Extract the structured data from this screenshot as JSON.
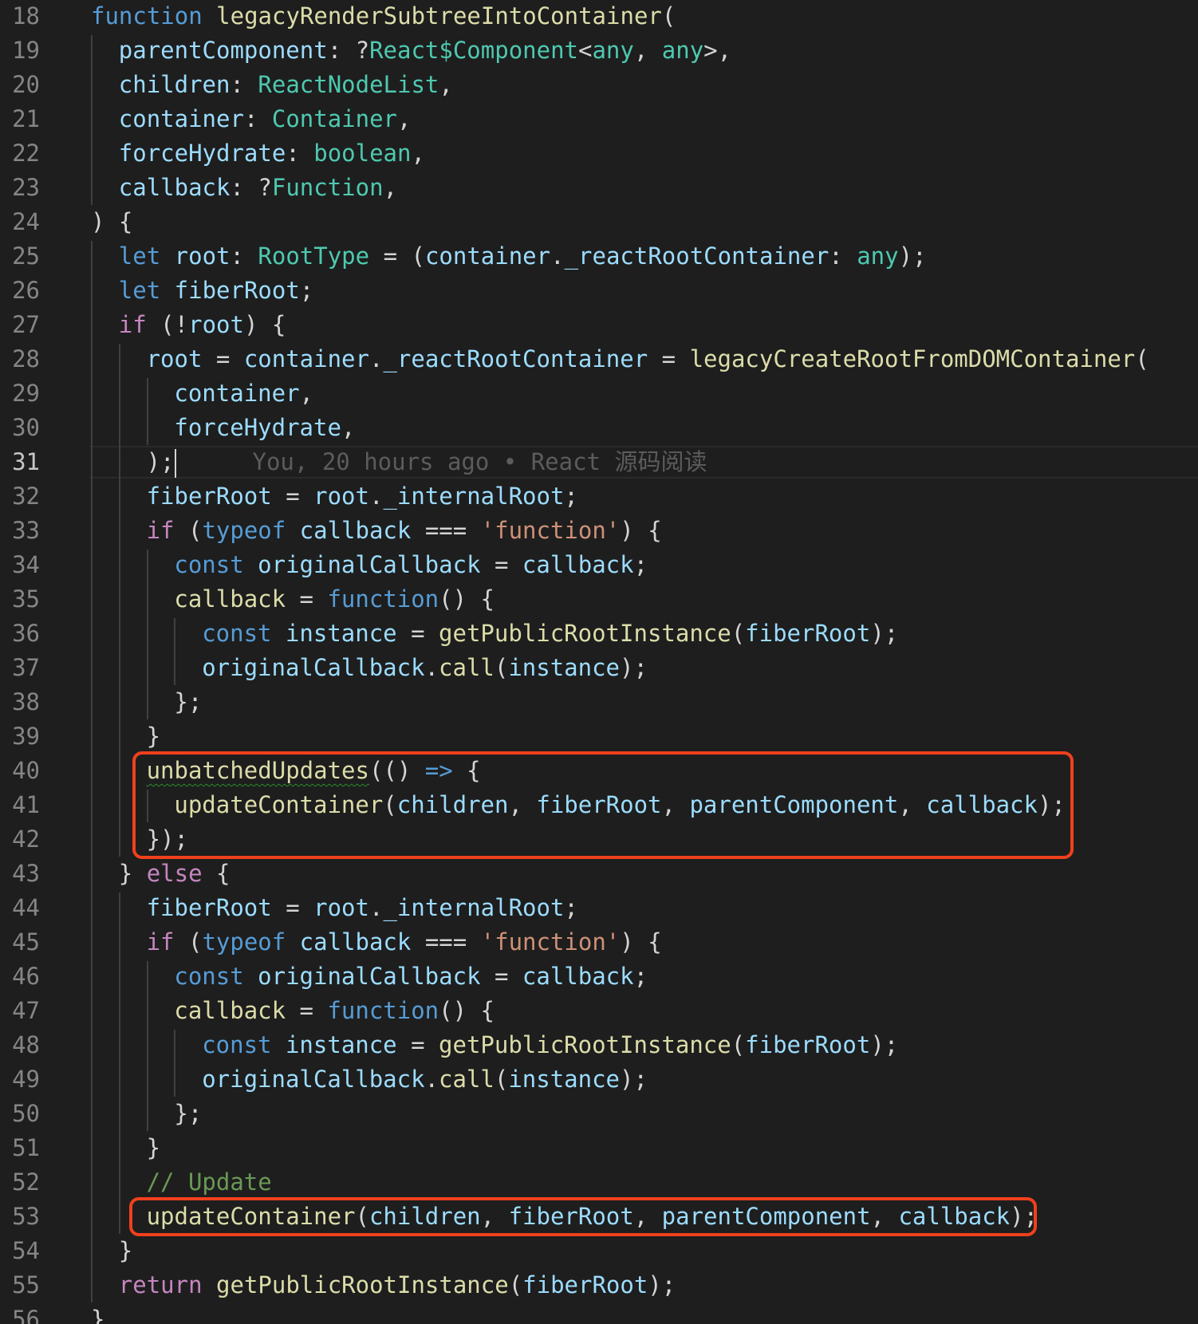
{
  "colors": {
    "background": "#1e1e1e",
    "keyword": "#569cd6",
    "control": "#c586c0",
    "function": "#dcdcaa",
    "variable": "#9cdcfe",
    "type": "#4ec9b0",
    "string": "#ce9178",
    "comment": "#6a9955",
    "highlight": "#f0401c"
  },
  "editor": {
    "current_line": "31",
    "blame_text": "You, 20 hours ago • React 源码阅读",
    "lines": [
      {
        "num": "18",
        "indent": 0,
        "tokens": [
          [
            "k",
            "function"
          ],
          [
            "p",
            " "
          ],
          [
            "f",
            "legacyRenderSubtreeIntoContainer"
          ],
          [
            "p",
            "("
          ]
        ]
      },
      {
        "num": "19",
        "indent": 1,
        "tokens": [
          [
            "v",
            "parentComponent"
          ],
          [
            "p",
            ": ?"
          ],
          [
            "t",
            "React$Component"
          ],
          [
            "p",
            "<"
          ],
          [
            "t",
            "any"
          ],
          [
            "p",
            ", "
          ],
          [
            "t",
            "any"
          ],
          [
            "p",
            ">,"
          ]
        ]
      },
      {
        "num": "20",
        "indent": 1,
        "tokens": [
          [
            "v",
            "children"
          ],
          [
            "p",
            ": "
          ],
          [
            "t",
            "ReactNodeList"
          ],
          [
            "p",
            ","
          ]
        ]
      },
      {
        "num": "21",
        "indent": 1,
        "tokens": [
          [
            "v",
            "container"
          ],
          [
            "p",
            ": "
          ],
          [
            "t",
            "Container"
          ],
          [
            "p",
            ","
          ]
        ]
      },
      {
        "num": "22",
        "indent": 1,
        "tokens": [
          [
            "v",
            "forceHydrate"
          ],
          [
            "p",
            ": "
          ],
          [
            "t",
            "boolean"
          ],
          [
            "p",
            ","
          ]
        ]
      },
      {
        "num": "23",
        "indent": 1,
        "tokens": [
          [
            "v",
            "callback"
          ],
          [
            "p",
            ": ?"
          ],
          [
            "t",
            "Function"
          ],
          [
            "p",
            ","
          ]
        ]
      },
      {
        "num": "24",
        "indent": 0,
        "tokens": [
          [
            "p",
            ") {"
          ]
        ]
      },
      {
        "num": "25",
        "indent": 1,
        "tokens": [
          [
            "k",
            "let"
          ],
          [
            "p",
            " "
          ],
          [
            "v",
            "root"
          ],
          [
            "p",
            ": "
          ],
          [
            "t",
            "RootType"
          ],
          [
            "p",
            " = ("
          ],
          [
            "v",
            "container"
          ],
          [
            "p",
            "."
          ],
          [
            "v",
            "_reactRootContainer"
          ],
          [
            "p",
            ": "
          ],
          [
            "t",
            "any"
          ],
          [
            "p",
            ");"
          ]
        ]
      },
      {
        "num": "26",
        "indent": 1,
        "tokens": [
          [
            "k",
            "let"
          ],
          [
            "p",
            " "
          ],
          [
            "v",
            "fiberRoot"
          ],
          [
            "p",
            ";"
          ]
        ]
      },
      {
        "num": "27",
        "indent": 1,
        "tokens": [
          [
            "c",
            "if"
          ],
          [
            "p",
            " (!"
          ],
          [
            "v",
            "root"
          ],
          [
            "p",
            ") {"
          ]
        ]
      },
      {
        "num": "28",
        "indent": 2,
        "tokens": [
          [
            "v",
            "root"
          ],
          [
            "p",
            " = "
          ],
          [
            "v",
            "container"
          ],
          [
            "p",
            "."
          ],
          [
            "v",
            "_reactRootContainer"
          ],
          [
            "p",
            " = "
          ],
          [
            "f",
            "legacyCreateRootFromDOMContainer"
          ],
          [
            "p",
            "("
          ]
        ]
      },
      {
        "num": "29",
        "indent": 3,
        "tokens": [
          [
            "v",
            "container"
          ],
          [
            "p",
            ","
          ]
        ]
      },
      {
        "num": "30",
        "indent": 3,
        "tokens": [
          [
            "v",
            "forceHydrate"
          ],
          [
            "p",
            ","
          ]
        ]
      },
      {
        "num": "31",
        "indent": 2,
        "tokens": [
          [
            "p",
            ");"
          ]
        ]
      },
      {
        "num": "32",
        "indent": 2,
        "tokens": [
          [
            "v",
            "fiberRoot"
          ],
          [
            "p",
            " = "
          ],
          [
            "v",
            "root"
          ],
          [
            "p",
            "."
          ],
          [
            "v",
            "_internalRoot"
          ],
          [
            "p",
            ";"
          ]
        ]
      },
      {
        "num": "33",
        "indent": 2,
        "tokens": [
          [
            "c",
            "if"
          ],
          [
            "p",
            " ("
          ],
          [
            "k",
            "typeof"
          ],
          [
            "p",
            " "
          ],
          [
            "v",
            "callback"
          ],
          [
            "p",
            " === "
          ],
          [
            "s",
            "'function'"
          ],
          [
            "p",
            ") {"
          ]
        ]
      },
      {
        "num": "34",
        "indent": 3,
        "tokens": [
          [
            "k",
            "const"
          ],
          [
            "p",
            " "
          ],
          [
            "v",
            "originalCallback"
          ],
          [
            "p",
            " = "
          ],
          [
            "v",
            "callback"
          ],
          [
            "p",
            ";"
          ]
        ]
      },
      {
        "num": "35",
        "indent": 3,
        "tokens": [
          [
            "f",
            "callback"
          ],
          [
            "p",
            " = "
          ],
          [
            "k",
            "function"
          ],
          [
            "p",
            "() {"
          ]
        ]
      },
      {
        "num": "36",
        "indent": 4,
        "tokens": [
          [
            "k",
            "const"
          ],
          [
            "p",
            " "
          ],
          [
            "v",
            "instance"
          ],
          [
            "p",
            " = "
          ],
          [
            "f",
            "getPublicRootInstance"
          ],
          [
            "p",
            "("
          ],
          [
            "v",
            "fiberRoot"
          ],
          [
            "p",
            ");"
          ]
        ]
      },
      {
        "num": "37",
        "indent": 4,
        "tokens": [
          [
            "v",
            "originalCallback"
          ],
          [
            "p",
            "."
          ],
          [
            "f",
            "call"
          ],
          [
            "p",
            "("
          ],
          [
            "v",
            "instance"
          ],
          [
            "p",
            ");"
          ]
        ]
      },
      {
        "num": "38",
        "indent": 3,
        "tokens": [
          [
            "p",
            "};"
          ]
        ]
      },
      {
        "num": "39",
        "indent": 2,
        "tokens": [
          [
            "p",
            "}"
          ]
        ]
      },
      {
        "num": "40",
        "indent": 2,
        "tokens": [
          [
            "fs",
            "unbatchedUpdates"
          ],
          [
            "p",
            "(() "
          ],
          [
            "k",
            "=>"
          ],
          [
            "p",
            " {"
          ]
        ]
      },
      {
        "num": "41",
        "indent": 3,
        "tokens": [
          [
            "f",
            "updateContainer"
          ],
          [
            "p",
            "("
          ],
          [
            "v",
            "children"
          ],
          [
            "p",
            ", "
          ],
          [
            "v",
            "fiberRoot"
          ],
          [
            "p",
            ", "
          ],
          [
            "v",
            "parentComponent"
          ],
          [
            "p",
            ", "
          ],
          [
            "v",
            "callback"
          ],
          [
            "p",
            ");"
          ]
        ]
      },
      {
        "num": "42",
        "indent": 2,
        "tokens": [
          [
            "p",
            "});"
          ]
        ]
      },
      {
        "num": "43",
        "indent": 1,
        "tokens": [
          [
            "p",
            "} "
          ],
          [
            "c",
            "else"
          ],
          [
            "p",
            " {"
          ]
        ]
      },
      {
        "num": "44",
        "indent": 2,
        "tokens": [
          [
            "v",
            "fiberRoot"
          ],
          [
            "p",
            " = "
          ],
          [
            "v",
            "root"
          ],
          [
            "p",
            "."
          ],
          [
            "v",
            "_internalRoot"
          ],
          [
            "p",
            ";"
          ]
        ]
      },
      {
        "num": "45",
        "indent": 2,
        "tokens": [
          [
            "c",
            "if"
          ],
          [
            "p",
            " ("
          ],
          [
            "k",
            "typeof"
          ],
          [
            "p",
            " "
          ],
          [
            "v",
            "callback"
          ],
          [
            "p",
            " === "
          ],
          [
            "s",
            "'function'"
          ],
          [
            "p",
            ") {"
          ]
        ]
      },
      {
        "num": "46",
        "indent": 3,
        "tokens": [
          [
            "k",
            "const"
          ],
          [
            "p",
            " "
          ],
          [
            "v",
            "originalCallback"
          ],
          [
            "p",
            " = "
          ],
          [
            "v",
            "callback"
          ],
          [
            "p",
            ";"
          ]
        ]
      },
      {
        "num": "47",
        "indent": 3,
        "tokens": [
          [
            "f",
            "callback"
          ],
          [
            "p",
            " = "
          ],
          [
            "k",
            "function"
          ],
          [
            "p",
            "() {"
          ]
        ]
      },
      {
        "num": "48",
        "indent": 4,
        "tokens": [
          [
            "k",
            "const"
          ],
          [
            "p",
            " "
          ],
          [
            "v",
            "instance"
          ],
          [
            "p",
            " = "
          ],
          [
            "f",
            "getPublicRootInstance"
          ],
          [
            "p",
            "("
          ],
          [
            "v",
            "fiberRoot"
          ],
          [
            "p",
            ");"
          ]
        ]
      },
      {
        "num": "49",
        "indent": 4,
        "tokens": [
          [
            "v",
            "originalCallback"
          ],
          [
            "p",
            "."
          ],
          [
            "f",
            "call"
          ],
          [
            "p",
            "("
          ],
          [
            "v",
            "instance"
          ],
          [
            "p",
            ");"
          ]
        ]
      },
      {
        "num": "50",
        "indent": 3,
        "tokens": [
          [
            "p",
            "};"
          ]
        ]
      },
      {
        "num": "51",
        "indent": 2,
        "tokens": [
          [
            "p",
            "}"
          ]
        ]
      },
      {
        "num": "52",
        "indent": 2,
        "tokens": [
          [
            "m",
            "// Update"
          ]
        ]
      },
      {
        "num": "53",
        "indent": 2,
        "tokens": [
          [
            "f",
            "updateContainer"
          ],
          [
            "p",
            "("
          ],
          [
            "v",
            "children"
          ],
          [
            "p",
            ", "
          ],
          [
            "v",
            "fiberRoot"
          ],
          [
            "p",
            ", "
          ],
          [
            "v",
            "parentComponent"
          ],
          [
            "p",
            ", "
          ],
          [
            "v",
            "callback"
          ],
          [
            "p",
            ");"
          ]
        ]
      },
      {
        "num": "54",
        "indent": 1,
        "tokens": [
          [
            "p",
            "}"
          ]
        ]
      },
      {
        "num": "55",
        "indent": 1,
        "tokens": [
          [
            "c",
            "return"
          ],
          [
            "p",
            " "
          ],
          [
            "f",
            "getPublicRootInstance"
          ],
          [
            "p",
            "("
          ],
          [
            "v",
            "fiberRoot"
          ],
          [
            "p",
            ");"
          ]
        ]
      },
      {
        "num": "56",
        "indent": 0,
        "tokens": [
          [
            "p",
            "}"
          ]
        ]
      }
    ]
  },
  "annotations": [
    {
      "label": "unbatched-updates-box",
      "from_line": "40",
      "to_line": "42"
    },
    {
      "label": "update-container-box",
      "from_line": "53",
      "to_line": "53"
    }
  ]
}
